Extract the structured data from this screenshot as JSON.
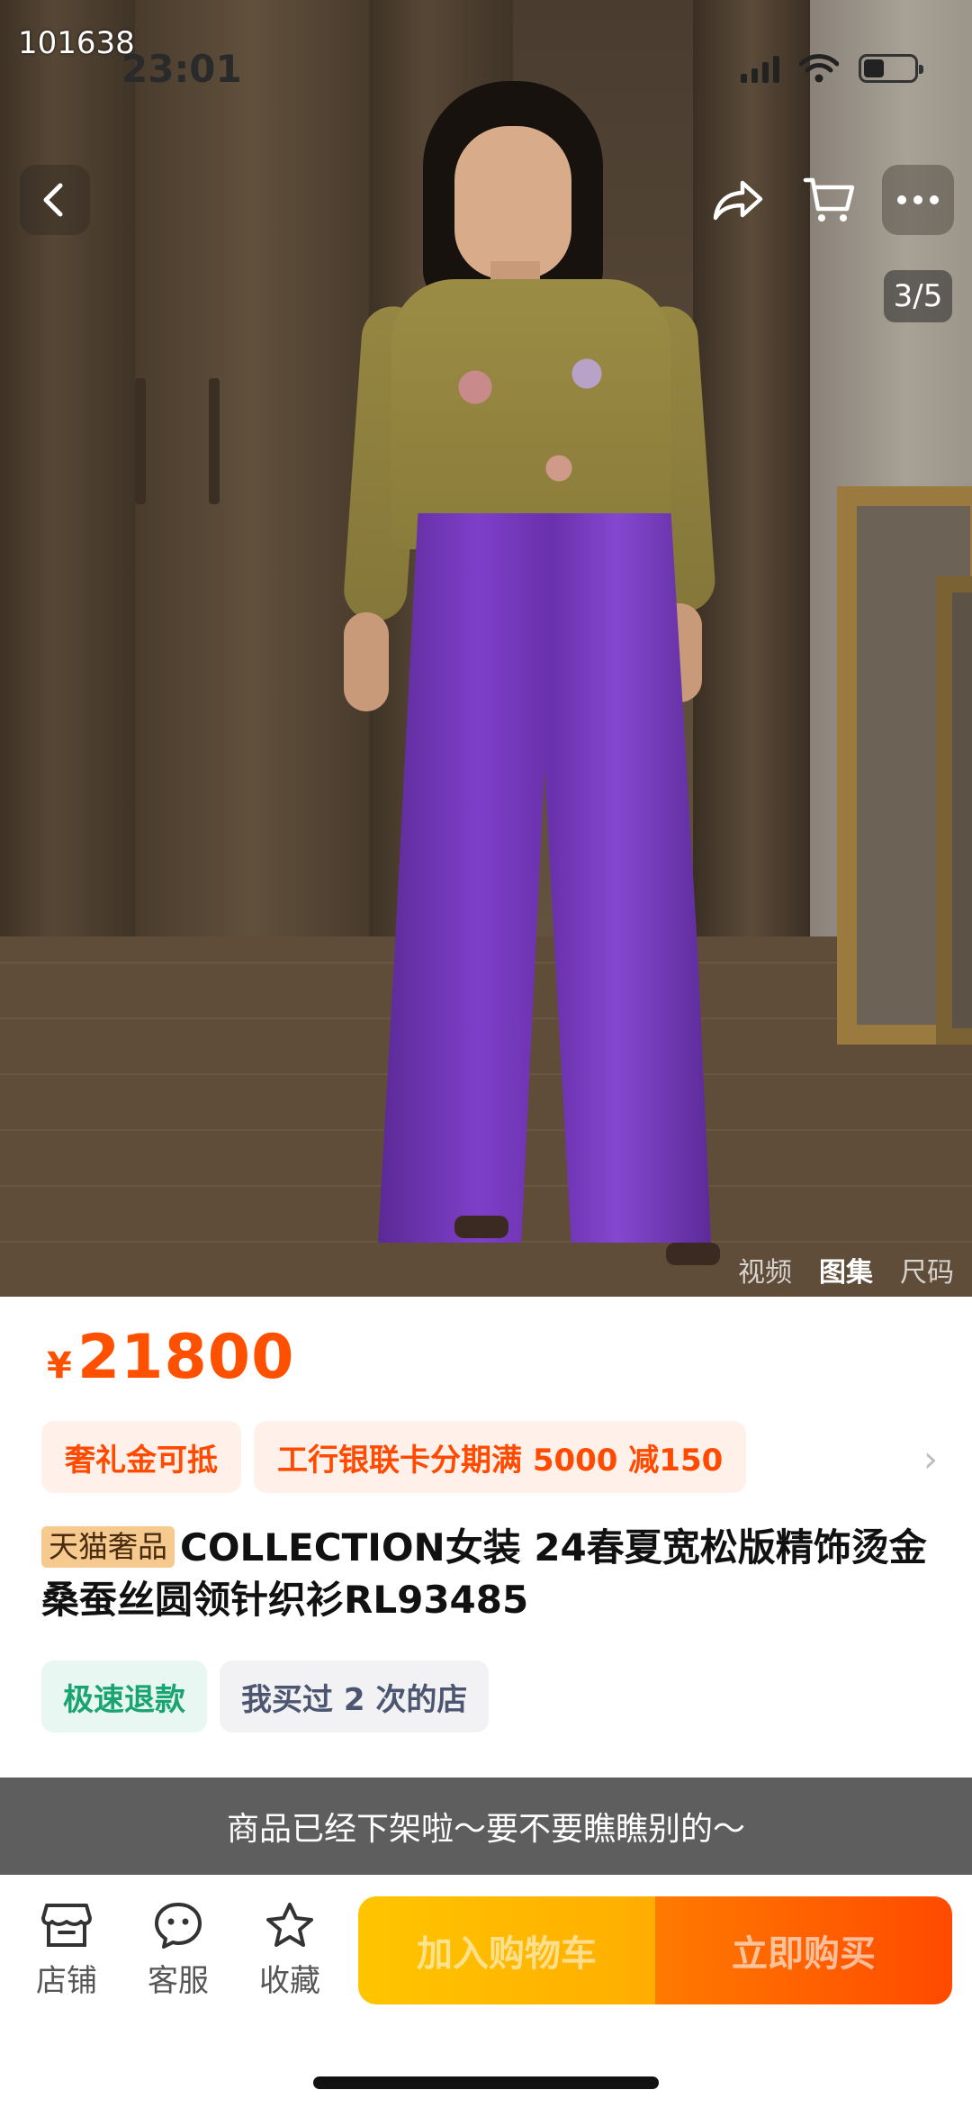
{
  "overlay": {
    "id_label": "101638"
  },
  "status_bar": {
    "time": "23:01"
  },
  "gallery": {
    "page_indicator": "3/5",
    "tabs": [
      "视频",
      "图集",
      "尺码"
    ],
    "active_tab_index": 1
  },
  "icons": {
    "back": "chevron-left-icon",
    "share": "share-arrow-icon",
    "cart": "cart-icon",
    "more": "more-dots-icon",
    "store": "store-icon",
    "service": "chat-face-icon",
    "favorite": "star-icon"
  },
  "product": {
    "currency": "¥",
    "price": "21800",
    "promos": [
      "奢礼金可抵",
      "工行银联卡分期满 5000 减150"
    ],
    "brand_tag": "天猫奢品",
    "title": "COLLECTION女装 24春夏宽松版精饰烫金桑蚕丝圆领针织衫RL93485",
    "services": [
      "极速退款",
      "我买过 2 次的店"
    ]
  },
  "toast": {
    "message": "商品已经下架啦～要不要瞧瞧别的～"
  },
  "bottom_bar": {
    "store": "店铺",
    "customer_service": "客服",
    "favorite": "收藏",
    "add_to_cart": "加入购物车",
    "buy_now": "立即购买"
  },
  "colors": {
    "price": "#ff5000",
    "promo_bg": "#fff1ea",
    "cart_button": "#ffc500",
    "buy_button": "#ff5000",
    "toast_bg": "#505050"
  }
}
